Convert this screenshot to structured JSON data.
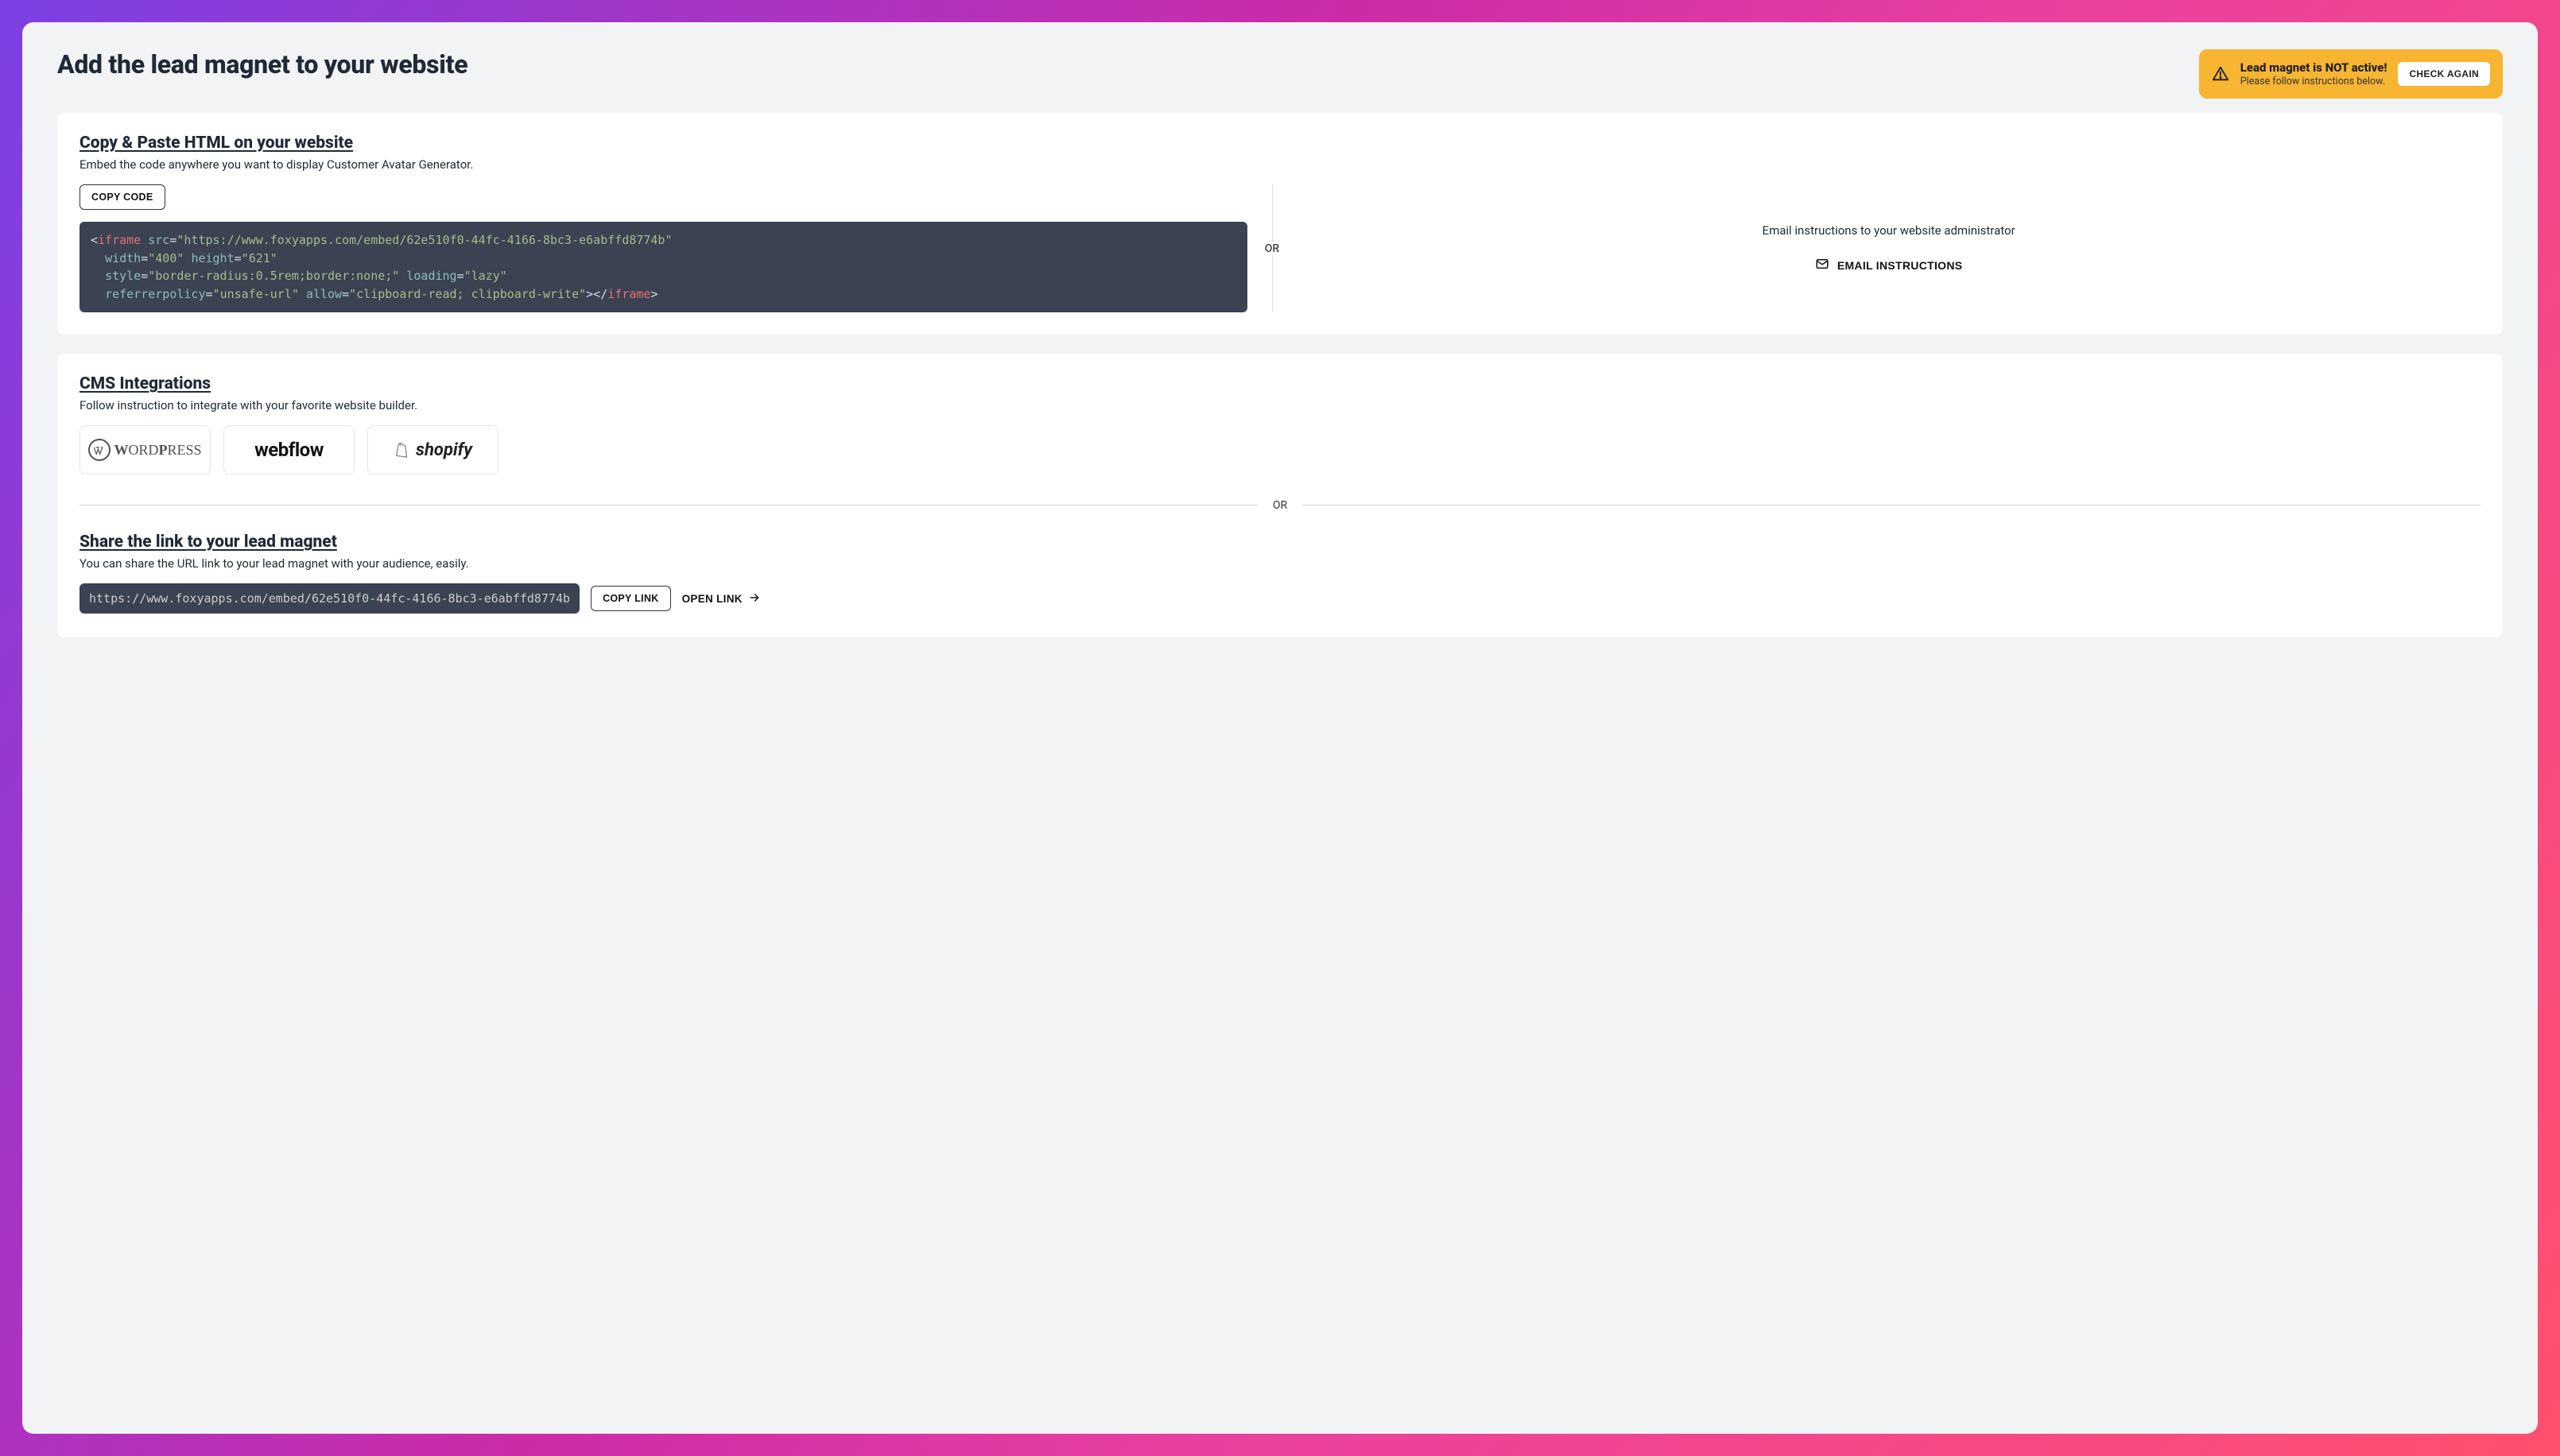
{
  "header": {
    "title": "Add the lead magnet to your website"
  },
  "alert": {
    "title": "Lead magnet is NOT active!",
    "subtitle": "Please follow instructions below.",
    "button_label": "CHECK AGAIN"
  },
  "copy_section": {
    "title": "Copy & Paste HTML on your website",
    "subtitle": "Embed the code anywhere you want to display Customer Avatar Generator.",
    "copy_button_label": "COPY CODE",
    "code": {
      "tag": "iframe",
      "src": "https://www.foxyapps.com/embed/62e510f0-44fc-4166-8bc3-e6abffd8774b",
      "width": "400",
      "height": "621",
      "style": "border-radius:0.5rem;border:none;",
      "loading": "lazy",
      "referrerpolicy": "unsafe-url",
      "allow": "clipboard-read; clipboard-write"
    },
    "or_label": "OR",
    "email_prompt": "Email instructions to your website administrator",
    "email_button_label": "EMAIL INSTRUCTIONS"
  },
  "cms_section": {
    "title": "CMS Integrations",
    "subtitle": "Follow instruction to integrate with your favorite website builder.",
    "integrations": [
      {
        "name": "WordPress"
      },
      {
        "name": "Webflow"
      },
      {
        "name": "Shopify"
      }
    ]
  },
  "or_label_mid": "OR",
  "share_section": {
    "title": "Share the link to your lead magnet",
    "subtitle": "You can share the URL link to your lead magnet with your audience, easily.",
    "link": "https://www.foxyapps.com/embed/62e510f0-44fc-4166-8bc3-e6abffd8774b",
    "copy_link_label": "COPY LINK",
    "open_link_label": "OPEN LINK"
  }
}
